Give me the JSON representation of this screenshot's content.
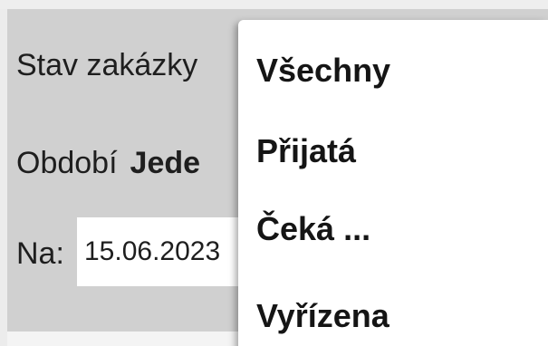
{
  "filter": {
    "status_label": "Stav zakázky",
    "period_label": "Období",
    "period_value": "Jede",
    "to_label": "Na:",
    "to_date": "15.06.2023"
  },
  "dropdown": {
    "items": [
      {
        "label": "Všechny"
      },
      {
        "label": "Přijatá"
      },
      {
        "label": "Čeká ..."
      },
      {
        "label": "Vyřízena"
      }
    ]
  },
  "colors": {
    "panel_background": "#d0d0d0",
    "menu_background": "#ffffff",
    "text": "#1e1e1e"
  }
}
